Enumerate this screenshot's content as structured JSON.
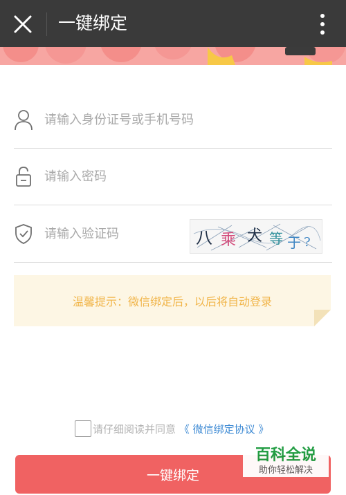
{
  "header": {
    "title": "一键绑定",
    "close_icon": "close-icon",
    "more_icon": "more-vertical-icon",
    "background": "#3a3a3a"
  },
  "form": {
    "username": {
      "placeholder": "请输入身份证号或手机号码",
      "value": "",
      "icon": "user-icon"
    },
    "password": {
      "placeholder": "请输入密码",
      "value": "",
      "icon": "lock-icon"
    },
    "captcha": {
      "placeholder": "请输入验证码",
      "value": "",
      "icon": "shield-check-icon",
      "image_text": "八 乘 犬 等 于 ?"
    }
  },
  "tip": {
    "text": "温馨提示：微信绑定后，以后将自动登录",
    "color": "#f1b54a",
    "background": "#fdf6e4"
  },
  "agreement": {
    "text": "请仔细阅读并同意",
    "link_text": "《 微信绑定协议 》",
    "link_color": "#3f8bd4",
    "checked": false
  },
  "submit": {
    "label": "一键绑定",
    "color": "#f06262"
  },
  "watermark": {
    "title": "百科全说",
    "subtitle": "助你轻松解决"
  }
}
